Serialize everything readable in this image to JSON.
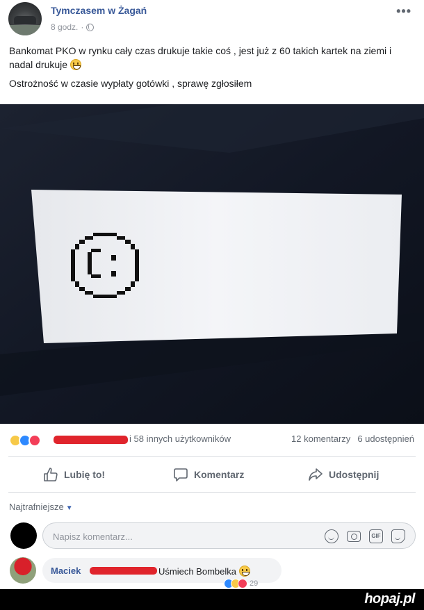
{
  "post": {
    "page_name": "Tymczasem w Żagań",
    "time": "8 godz.",
    "separator": "·",
    "more": "•••",
    "text_line1": "Bankomat PKO w rynku cały czas drukuje takie coś , jest już z 60 takich kartek na ziemi i nadal drukuje",
    "text_line2": "Ostrożność w czasie wypłaty gotówki , sprawę zgłosiłem"
  },
  "reactions": {
    "others": "i 58 innych użytkowników",
    "comments": "12 komentarzy",
    "shares": "6 udostępnień"
  },
  "actions": {
    "like": "Lubię to!",
    "comment": "Komentarz",
    "share": "Udostępnij"
  },
  "comments": {
    "sort_label": "Najtrafniejsze",
    "input_placeholder": "Napisz komentarz...",
    "gif_label": "GIF",
    "first": {
      "author": "Maciek",
      "text": "Uśmiech Bombelka",
      "reaction_count": "29"
    }
  },
  "watermark": "hopaj.pl",
  "colors": {
    "link": "#385898",
    "redaction": "#e0242c",
    "photo_background": "#151a25",
    "paper": "#f2f3f6"
  }
}
